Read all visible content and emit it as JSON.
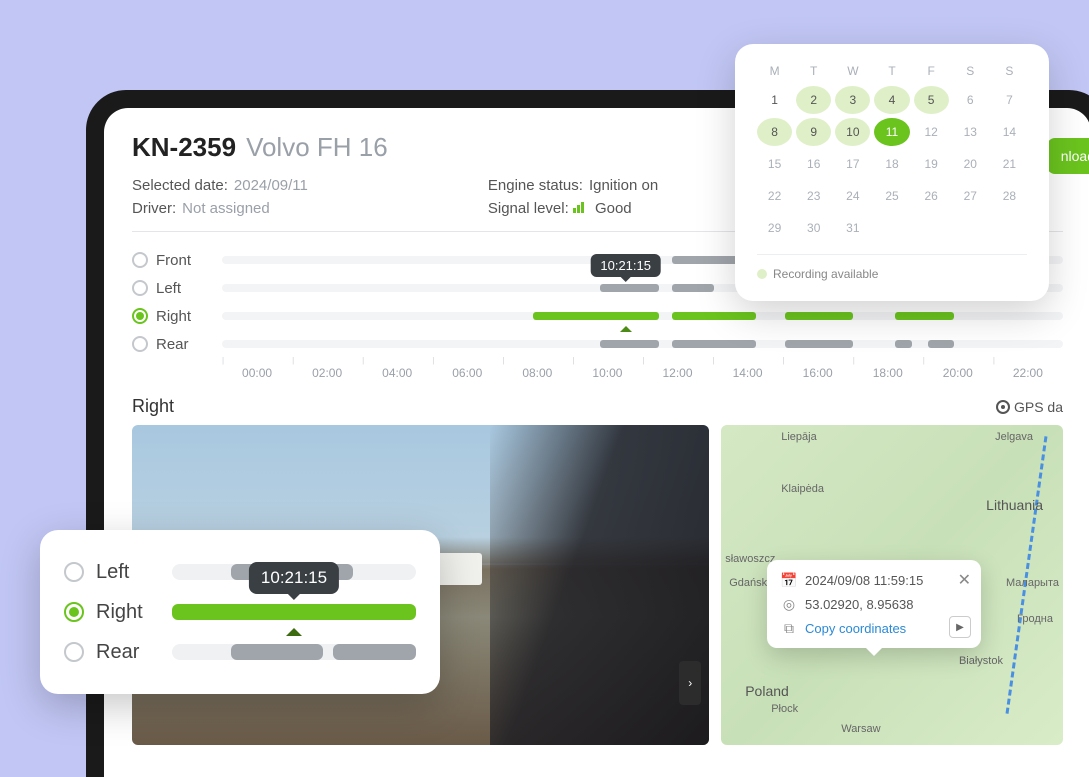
{
  "vehicle": {
    "id": "KN-2359",
    "model": "Volvo FH 16"
  },
  "info": {
    "selected_date_label": "Selected date:",
    "selected_date_value": "2024/09/11",
    "driver_label": "Driver:",
    "driver_value": "Not assigned",
    "engine_label": "Engine status:",
    "engine_value": "Ignition on",
    "signal_label": "Signal level:",
    "signal_value": "Good"
  },
  "cameras": {
    "front": "Front",
    "left": "Left",
    "right": "Right",
    "rear": "Rear"
  },
  "timeline": {
    "tooltip_time": "10:21:15",
    "hours": [
      "00:00",
      "02:00",
      "04:00",
      "06:00",
      "08:00",
      "10:00",
      "12:00",
      "14:00",
      "16:00",
      "18:00",
      "20:00",
      "22:00"
    ]
  },
  "view": {
    "current_label": "Right",
    "gps_label": "GPS da"
  },
  "download_button": "nload",
  "calendar": {
    "days_header": [
      "M",
      "T",
      "W",
      "T",
      "F",
      "S",
      "S"
    ],
    "rows": [
      [
        {
          "n": "1",
          "c": "dark"
        },
        {
          "n": "2",
          "c": "avail"
        },
        {
          "n": "3",
          "c": "avail"
        },
        {
          "n": "4",
          "c": "avail"
        },
        {
          "n": "5",
          "c": "avail"
        },
        {
          "n": "6",
          "c": ""
        },
        {
          "n": "7",
          "c": ""
        }
      ],
      [
        {
          "n": "8",
          "c": "avail"
        },
        {
          "n": "9",
          "c": "avail"
        },
        {
          "n": "10",
          "c": "avail"
        },
        {
          "n": "11",
          "c": "selected"
        },
        {
          "n": "12",
          "c": ""
        },
        {
          "n": "13",
          "c": ""
        },
        {
          "n": "14",
          "c": ""
        }
      ],
      [
        {
          "n": "15",
          "c": ""
        },
        {
          "n": "16",
          "c": ""
        },
        {
          "n": "17",
          "c": ""
        },
        {
          "n": "18",
          "c": ""
        },
        {
          "n": "19",
          "c": ""
        },
        {
          "n": "20",
          "c": ""
        },
        {
          "n": "21",
          "c": ""
        }
      ],
      [
        {
          "n": "22",
          "c": ""
        },
        {
          "n": "23",
          "c": ""
        },
        {
          "n": "24",
          "c": ""
        },
        {
          "n": "25",
          "c": ""
        },
        {
          "n": "26",
          "c": ""
        },
        {
          "n": "27",
          "c": ""
        },
        {
          "n": "28",
          "c": ""
        }
      ],
      [
        {
          "n": "29",
          "c": ""
        },
        {
          "n": "30",
          "c": ""
        },
        {
          "n": "31",
          "c": ""
        },
        {
          "n": "",
          "c": ""
        },
        {
          "n": "",
          "c": ""
        },
        {
          "n": "",
          "c": ""
        },
        {
          "n": "",
          "c": ""
        }
      ]
    ],
    "footer": "Recording available"
  },
  "zoom": {
    "left": "Left",
    "right": "Right",
    "rear": "Rear",
    "tooltip": "10:21:15"
  },
  "map": {
    "cities": {
      "liepaja": "Liepāja",
      "jelgava": "Jelgava",
      "klaipeda": "Klaipėda",
      "slawoszcz": "sławoszcz",
      "gdansk": "Gdańsk",
      "malaryta": "Маларыта",
      "grodno": "Гродна",
      "plock": "Płock",
      "bialystok": "Białystok",
      "warsaw": "Warsaw"
    },
    "countries": {
      "lithuania": "Lithuania",
      "poland": "Poland"
    }
  },
  "map_popup": {
    "datetime": "2024/09/08 11:59:15",
    "coords": "53.02920, 8.95638",
    "copy_label": "Copy coordinates"
  }
}
